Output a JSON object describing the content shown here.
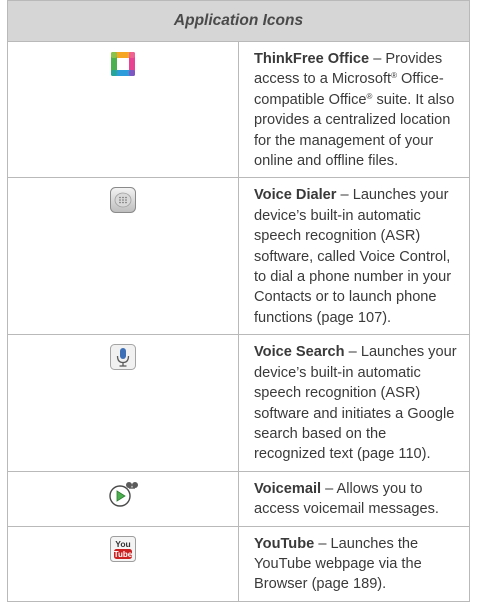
{
  "table": {
    "header": "Application Icons",
    "rows": [
      {
        "icon": "thinkfree-office-icon",
        "name": "ThinkFree Office",
        "dash": " – ",
        "desc_a": "Provides access to a Microsoft",
        "reg1": "®",
        "desc_b": " Office-compatible Office",
        "reg2": "®",
        "desc_c": " suite. It also provides a centralized location for the management of your online and offline files."
      },
      {
        "icon": "voice-dialer-icon",
        "name": "Voice Dialer",
        "dash": " – ",
        "desc": "Launches your device’s built-in automatic speech recognition (ASR) software, called Voice Control, to dial a phone number in your Contacts or to launch phone functions (page 107)."
      },
      {
        "icon": "voice-search-icon",
        "name": "Voice Search",
        "dash": " – ",
        "desc": "Launches your device’s built-in automatic speech recognition (ASR) software and initiates a Google search based on the recognized text (page 110)."
      },
      {
        "icon": "voicemail-icon",
        "name": "Voicemail",
        "dash": " – ",
        "desc": "Allows you to access voicemail messages."
      },
      {
        "icon": "youtube-icon",
        "icon_text_top": "You",
        "icon_text_bottom": "Tube",
        "name": "YouTube",
        "dash": " – ",
        "desc": "Launches the YouTube webpage via the Browser (page 189)."
      }
    ]
  }
}
